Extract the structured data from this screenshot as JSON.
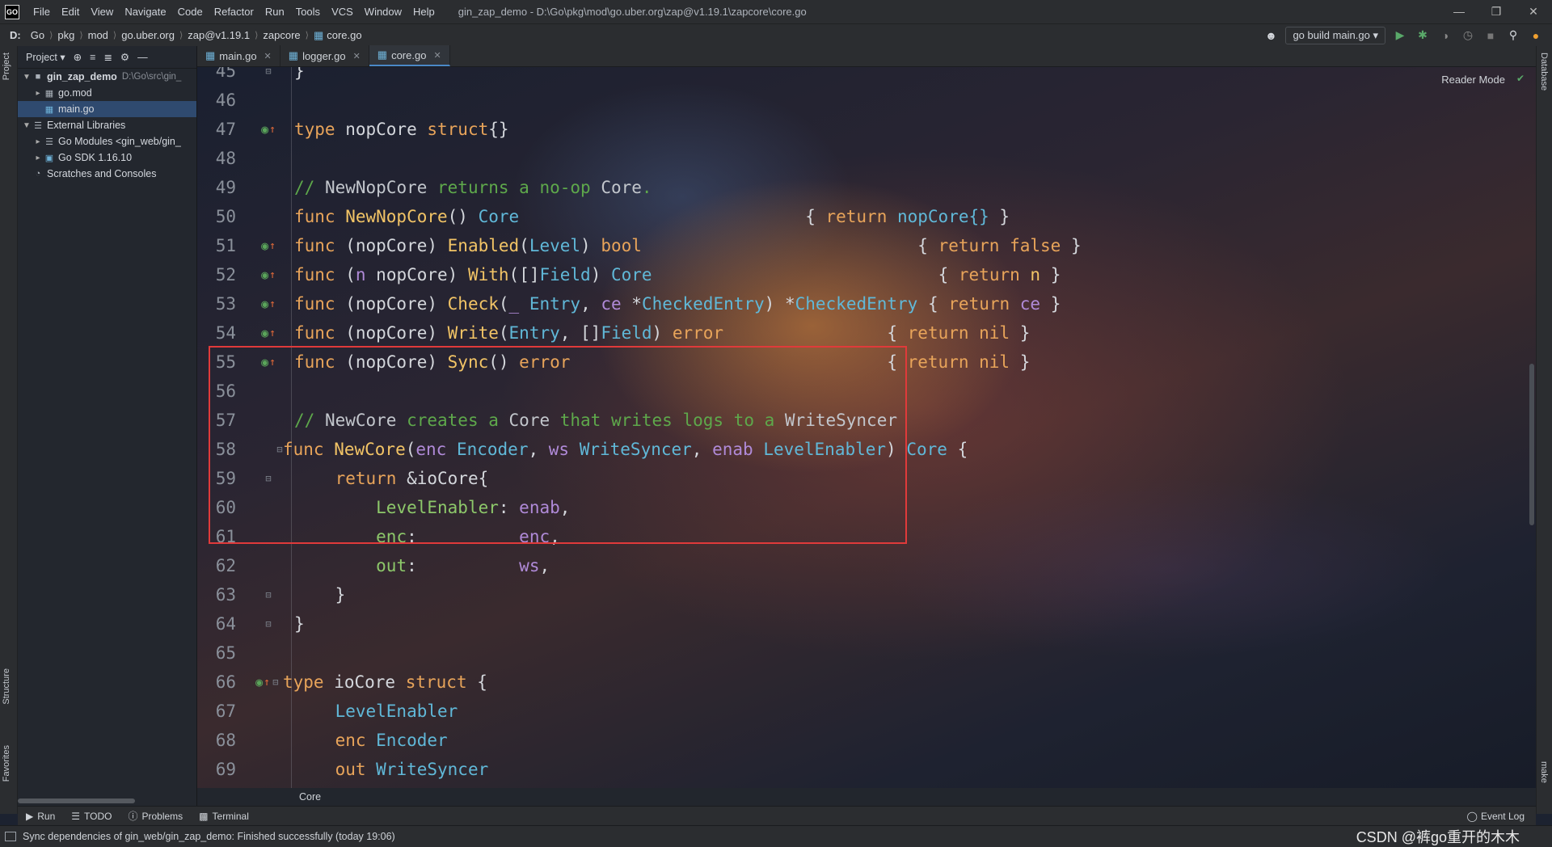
{
  "titlebar": {
    "menu": [
      "File",
      "Edit",
      "View",
      "Navigate",
      "Code",
      "Refactor",
      "Run",
      "Tools",
      "VCS",
      "Window",
      "Help"
    ],
    "window_title": "gin_zap_demo - D:\\Go\\pkg\\mod\\go.uber.org\\zap@v1.19.1\\zapcore\\core.go",
    "logo": "GO"
  },
  "navbar": {
    "crumbs": [
      "D:",
      "Go",
      "pkg",
      "mod",
      "go.uber.org",
      "zap@v1.19.1",
      "zapcore",
      "core.go"
    ],
    "run_config": "go build main.go"
  },
  "sidebar": {
    "left_labels": {
      "project": "Project",
      "structure": "Structure",
      "favorites": "Favorites"
    },
    "right_labels": {
      "database": "Database",
      "make": "make"
    },
    "header_label": "Project"
  },
  "project_tree": [
    {
      "label": "gin_zap_demo",
      "hint": "D:\\Go\\src\\gin_"
    },
    {
      "label": "go.mod",
      "hint": ""
    },
    {
      "label": "main.go",
      "hint": ""
    },
    {
      "label": "External Libraries",
      "hint": ""
    },
    {
      "label": "Go Modules <gin_web/gin_",
      "hint": ""
    },
    {
      "label": "Go SDK 1.16.10",
      "hint": ""
    },
    {
      "label": "Scratches and Consoles",
      "hint": ""
    }
  ],
  "tabs": [
    "main.go",
    "logger.go",
    "core.go"
  ],
  "editor": {
    "reader_mode": "Reader Mode",
    "line_numbers": [
      "45",
      "46",
      "47",
      "48",
      "49",
      "50",
      "51",
      "52",
      "53",
      "54",
      "55",
      "56",
      "57",
      "58",
      "59",
      "60",
      "61",
      "62",
      "63",
      "64",
      "65",
      "66",
      "67",
      "68",
      "69"
    ]
  },
  "code": {
    "l45": "}",
    "l47": {
      "kw1": "type",
      "name": " nopCore ",
      "kw2": "struct",
      "rest": "{}"
    },
    "l49": {
      "slashes": "// ",
      "a": "NewNopCore",
      "b": " returns a no-op ",
      "c": "Core",
      "d": "."
    },
    "l50": {
      "kw": "func ",
      "fn": "NewNopCore",
      "p": "() ",
      "t": "Core",
      "pad": "                            ",
      "body1": "{ ",
      "ret": "return",
      "val": " nopCore{}",
      "end": " }"
    },
    "l51": {
      "kw": "func ",
      "recv": "(nopCore) ",
      "fn": "Enabled",
      "p1": "(",
      "t1": "Level",
      "p2": ") ",
      "rt": "bool",
      "pad": "                           ",
      "body1": "{ ",
      "ret": "return",
      "val": " false",
      "end": " }"
    },
    "l52": {
      "kw": "func ",
      "recv1": "(",
      "pn": "n",
      "recv2": " nopCore) ",
      "fn": "With",
      "p1": "([]",
      "t1": "Field",
      "p2": ") ",
      "rt": "Core",
      "pad": "                            ",
      "body1": "{ ",
      "ret": "return",
      "val": " n",
      "end": " }"
    },
    "l53": {
      "kw": "func ",
      "recv": "(nopCore) ",
      "fn": "Check",
      "p1": "(",
      "pn1": "_",
      "sp": " ",
      "t1": "Entry",
      "c": ", ",
      "pn2": "ce",
      "star": " *",
      "t2": "CheckedEntry",
      "p2": ") *",
      "rt": "CheckedEntry",
      "pad": " ",
      "body1": "{ ",
      "ret": "return",
      "val": " ce",
      "end": " }"
    },
    "l54": {
      "kw": "func ",
      "recv": "(nopCore) ",
      "fn": "Write",
      "p1": "(",
      "t1": "Entry",
      "c": ", []",
      "t2": "Field",
      "p2": ") ",
      "rt": "error",
      "pad": "                ",
      "body1": "{ ",
      "ret": "return",
      "val": " nil",
      "end": " }"
    },
    "l55": {
      "kw": "func ",
      "recv": "(nopCore) ",
      "fn": "Sync",
      "p": "() ",
      "rt": "error",
      "pad": "                               ",
      "body1": "{ ",
      "ret": "return",
      "val": " nil",
      "end": " }"
    },
    "l57": {
      "slashes": "// ",
      "a": "NewCore",
      "b": " creates a ",
      "c": "Core",
      "d": " that writes logs to a ",
      "e": "WriteSyncer"
    },
    "l58": {
      "kw": "func ",
      "fn": "NewCore",
      "p1": "(",
      "pn1": "enc",
      "t1": " Encoder",
      "c1": ", ",
      "pn2": "ws",
      "t2": " WriteSyncer",
      "c2": ", ",
      "pn3": "enab",
      "t3": " LevelEnabler",
      "p2": ") ",
      "rt": "Core",
      "end": " {"
    },
    "l59": {
      "indent": "    ",
      "ret": "return",
      "rest": " &ioCore{"
    },
    "l60": {
      "indent": "        ",
      "field": "LevelEnabler",
      "colon": ": ",
      "val": "enab",
      "c": ","
    },
    "l61": {
      "indent": "        ",
      "field": "enc",
      "colon": ":          ",
      "val": "enc",
      "c": ","
    },
    "l62": {
      "indent": "        ",
      "field": "out",
      "colon": ":          ",
      "val": "ws",
      "c": ","
    },
    "l63": {
      "indent": "    ",
      "brace": "}"
    },
    "l64": "}",
    "l66": {
      "kw1": "type",
      "name": " ioCore ",
      "kw2": "struct",
      "rest": " {"
    },
    "l67": {
      "indent": "    ",
      "t": "LevelEnabler"
    },
    "l68": {
      "indent": "    ",
      "f": "enc",
      "t": " Encoder"
    },
    "l69": {
      "indent": "    ",
      "f": "out",
      "t": " WriteSyncer"
    }
  },
  "breadcrumb_bottom": "Core",
  "bottom_tools": [
    "Run",
    "TODO",
    "Problems",
    "Terminal"
  ],
  "event_log": "Event Log",
  "status": {
    "message": "Sync dependencies of gin_web/gin_zap_demo: Finished successfully (today 19:06)",
    "watermark": "CSDN @裤go重开的木木"
  },
  "colors": {
    "highlight_box": "#e03a3a",
    "keyword": "#e8a45a",
    "function": "#f2c466",
    "type": "#60b8d8",
    "comment": "#5ea84b"
  }
}
